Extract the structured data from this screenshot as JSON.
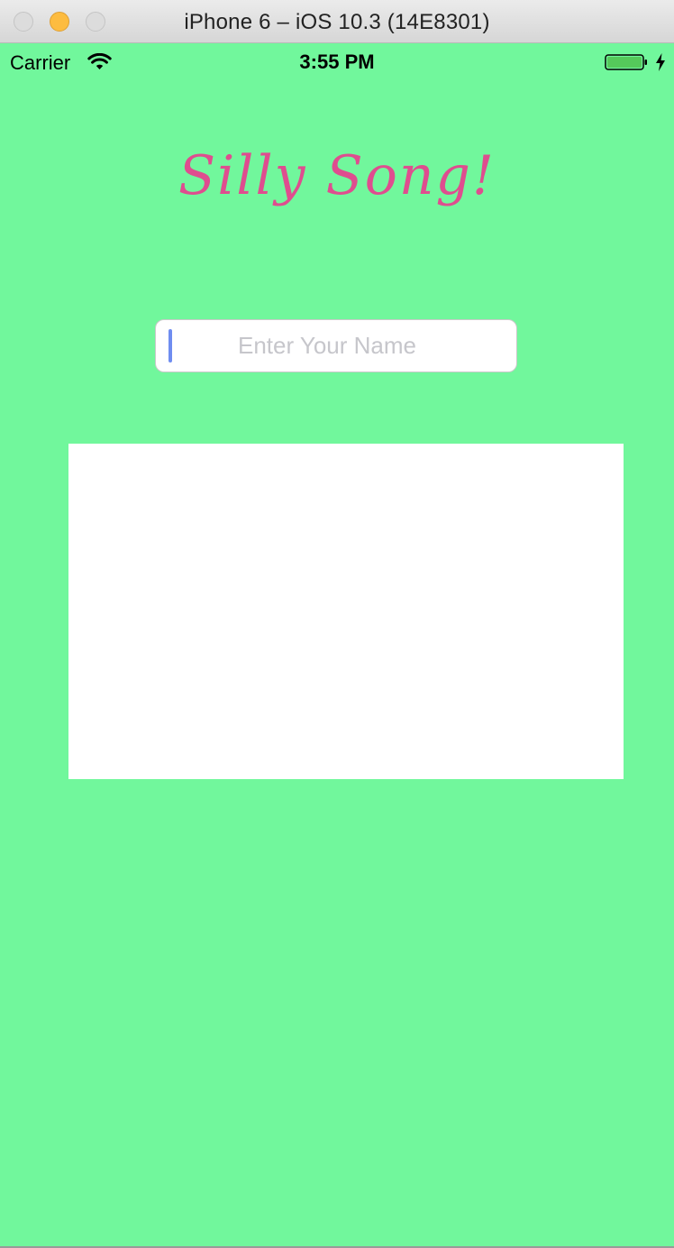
{
  "window": {
    "title": "iPhone 6 – iOS 10.3 (14E8301)"
  },
  "status_bar": {
    "carrier": "Carrier",
    "time": "3:55 PM",
    "icons": [
      "wifi-icon",
      "battery-icon",
      "charging-bolt-icon"
    ]
  },
  "app": {
    "title": "Silly Song!",
    "name_input": {
      "value": "",
      "placeholder": "Enter Your Name"
    },
    "lyrics_text": ""
  },
  "colors": {
    "background": "#71f79c",
    "title": "#df4d8f",
    "caret": "#6f8df0",
    "placeholder": "#c6c6cb"
  }
}
